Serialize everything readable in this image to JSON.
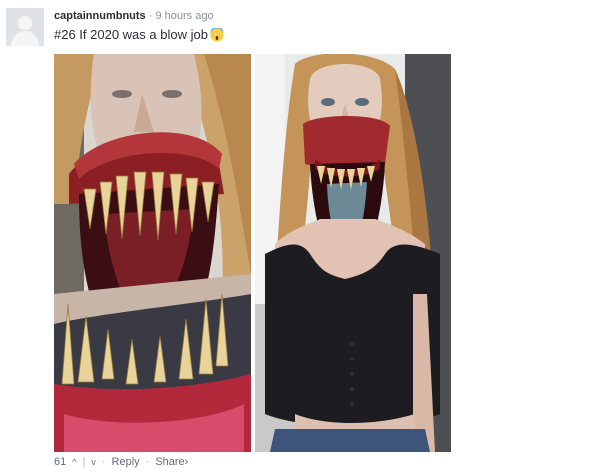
{
  "comment": {
    "username": "captainnumbnuts",
    "separator": "·",
    "timestamp": "9 hours ago",
    "text": "#26 If 2020 was a blow job",
    "emoji": "screaming-face-emoji"
  },
  "footer": {
    "upvotes": "61",
    "upvote_icon": "^",
    "divider": "|",
    "downvote_icon": "v",
    "dot1": "·",
    "reply_label": "Reply",
    "dot2": "·",
    "share_label": "Share",
    "share_chevron": "›"
  },
  "images": [
    {
      "name": "zombie-makeup-closeup"
    },
    {
      "name": "zombie-makeup-full-body"
    }
  ],
  "colors": {
    "username": "#2a2e33",
    "meta": "#8a939c",
    "footer_text": "#656c7a",
    "avatar_bg": "#dfe3e6"
  }
}
